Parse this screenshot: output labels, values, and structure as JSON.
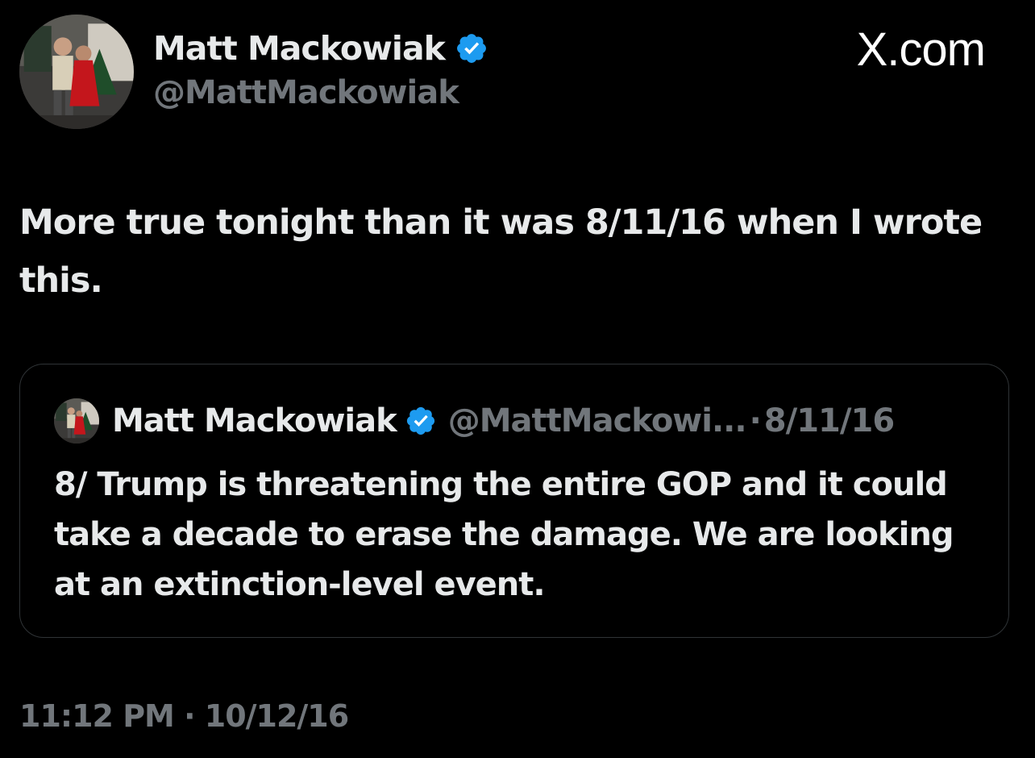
{
  "author": {
    "name": "Matt Mackowiak",
    "handle": "@MattMackowiak",
    "avatar_icon": "profile-photo",
    "verified_icon": "verified-badge-icon",
    "verified_color": "#1d9bf0"
  },
  "brand": {
    "label": "X.com"
  },
  "tweet": {
    "text": "More true tonight than it was 8/11/16 when I wrote this.",
    "time": "11:12 PM",
    "separator": "·",
    "date": "10/12/16"
  },
  "quoted": {
    "name": "Matt Mackowiak",
    "handle": "@MattMackowi...",
    "separator": "·",
    "date": "8/11/16",
    "text": "8/ Trump is threatening the entire GOP and it could take a decade to erase the damage. We are looking at an extinction-level event."
  },
  "colors": {
    "background": "#000000",
    "text_primary": "#e7e9ea",
    "text_secondary": "#71767b",
    "border": "#2f3336",
    "accent": "#1d9bf0"
  }
}
